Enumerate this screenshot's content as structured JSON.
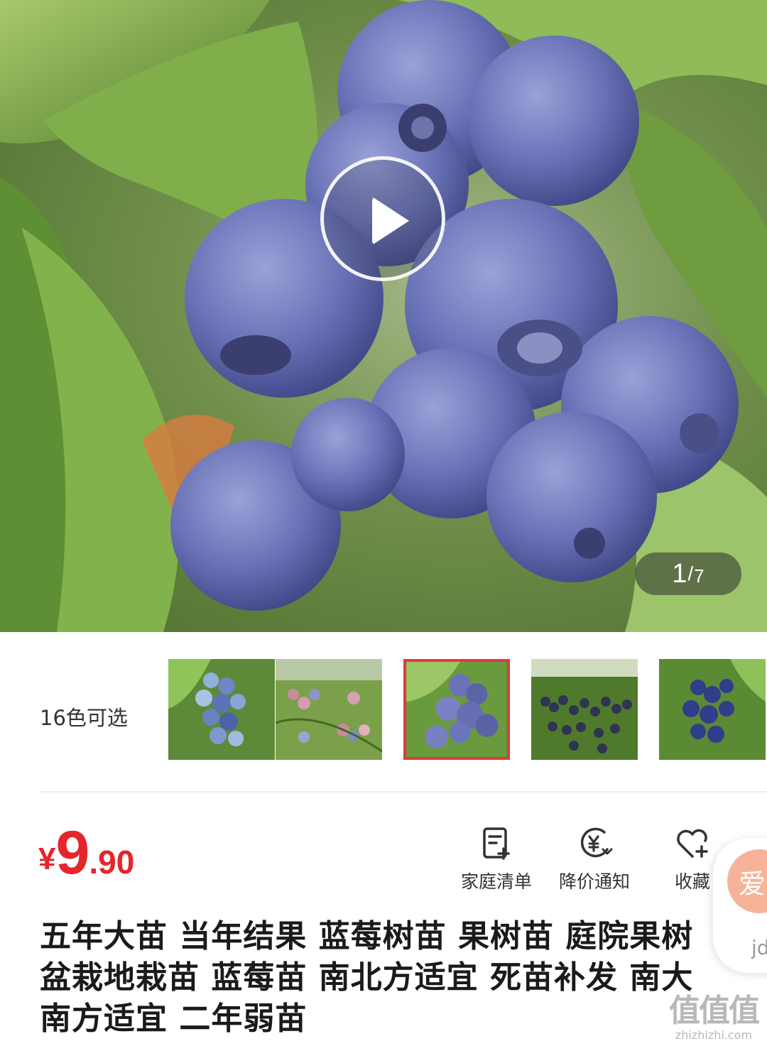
{
  "gallery": {
    "current": "1",
    "total": "7",
    "image": "blueberry-cluster-photo"
  },
  "variants": {
    "label": "16色可选",
    "thumbnails": [
      "blueberry-thumb-1",
      "blueberry-thumb-2",
      "blueberry-thumb-3",
      "blueberry-thumb-4",
      "blueberry-thumb-5"
    ],
    "selected_index": 2
  },
  "price": {
    "symbol": "¥",
    "integer": "9",
    "decimal": ".90",
    "color": "#e4262c"
  },
  "actions": [
    {
      "label": "家庭清单",
      "icon": "list-add-icon"
    },
    {
      "label": "降价通知",
      "icon": "price-drop-icon"
    },
    {
      "label": "收藏",
      "icon": "heart-add-icon"
    }
  ],
  "float": {
    "circle_text": "爱",
    "text": "jd"
  },
  "product": {
    "title": "五年大苗 当年结果 蓝莓树苗 果树苗 庭院果树 盆栽地栽苗 蓝莓苗 南北方适宜  死苗补发 南大 南方适宜 二年弱苗"
  },
  "watermark": {
    "big": "值值值",
    "small": "zhizhizhi.com"
  }
}
